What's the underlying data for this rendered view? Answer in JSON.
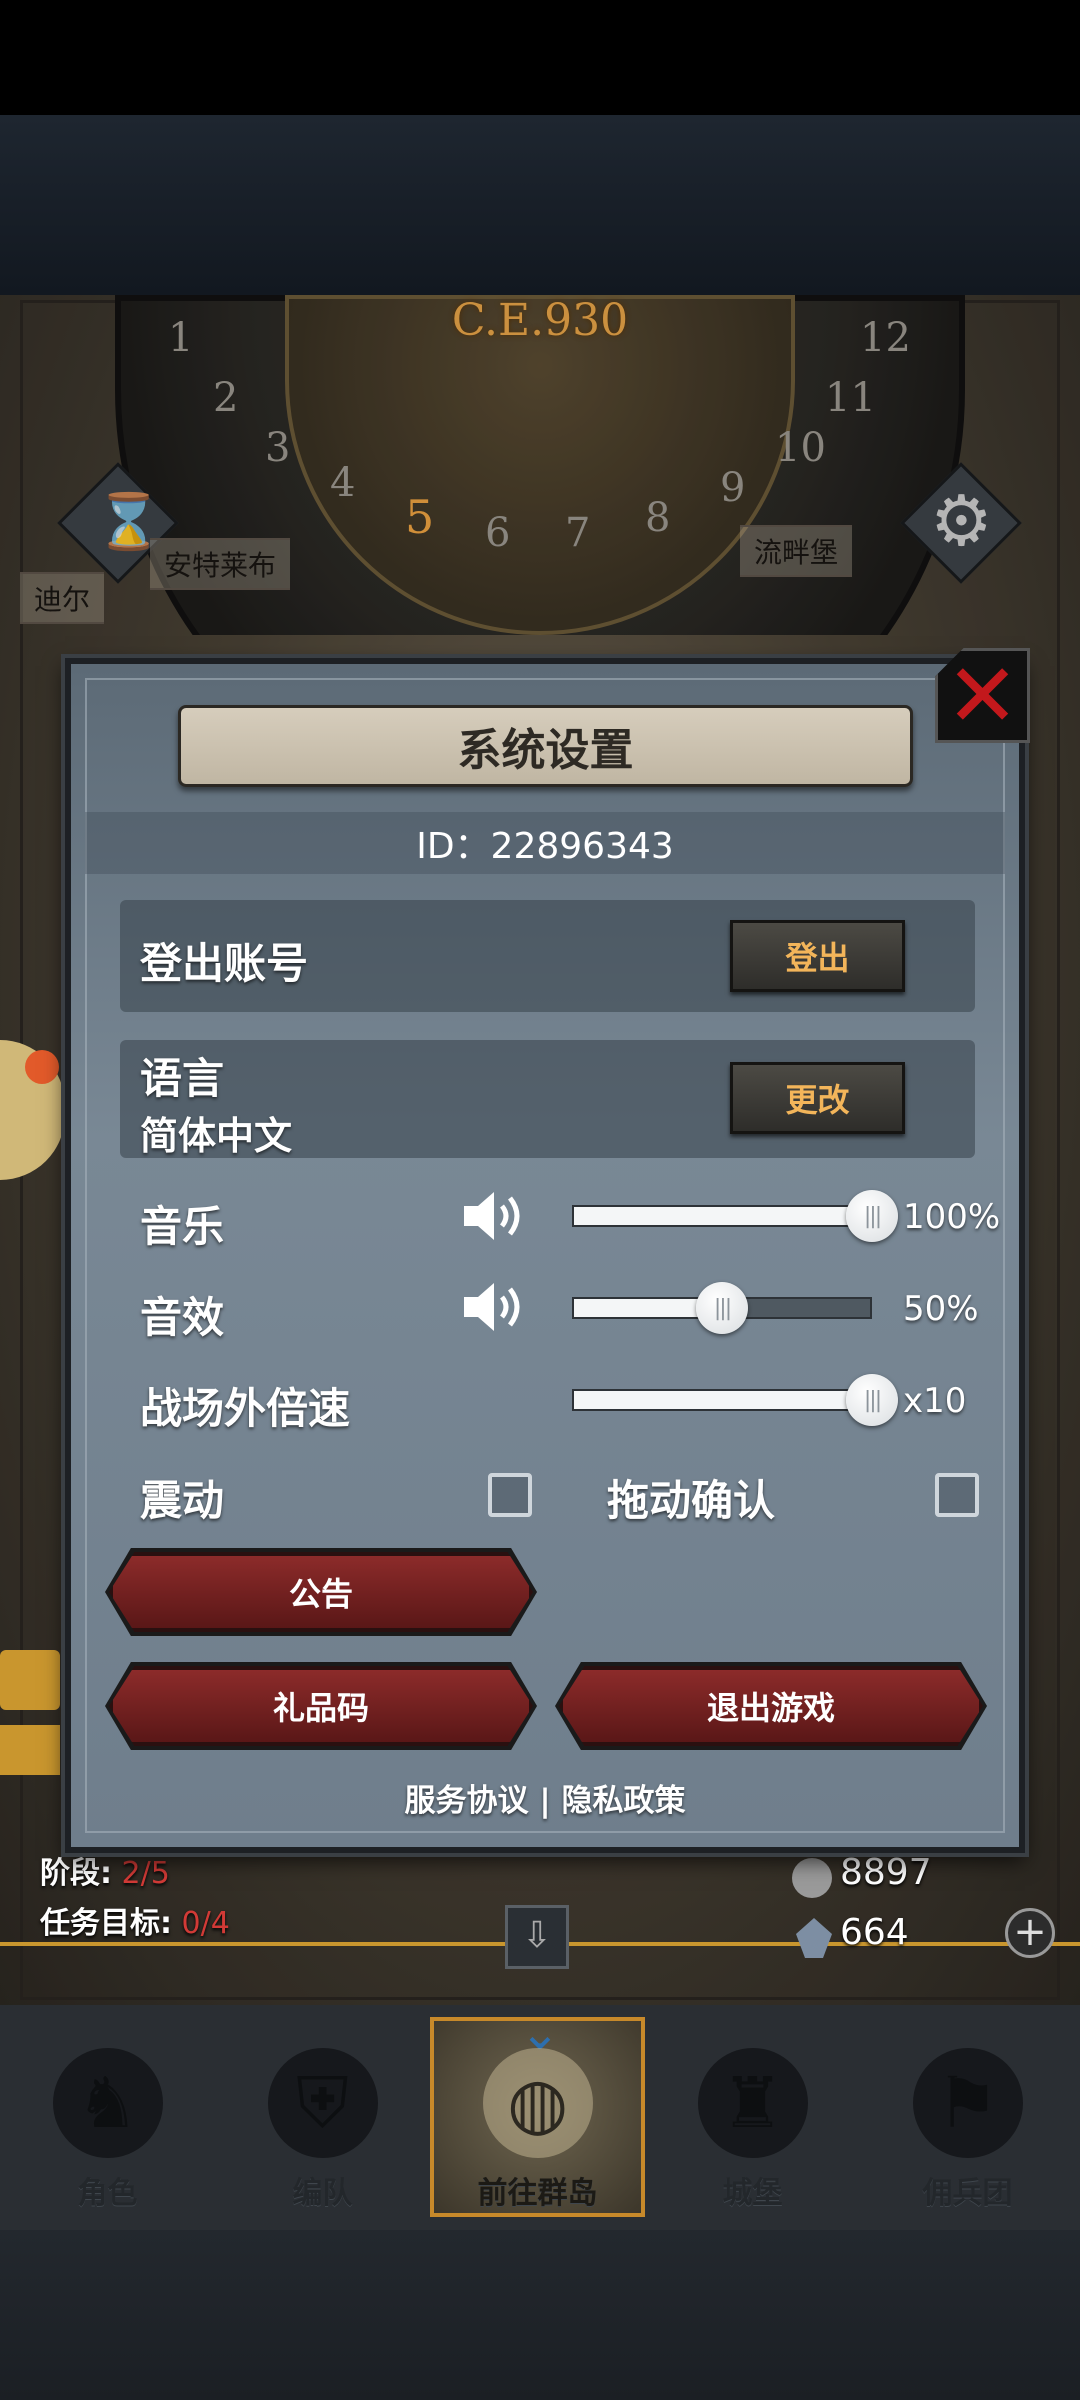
{
  "map": {
    "era": "C.E.930",
    "dial_numbers": [
      "1",
      "2",
      "3",
      "4",
      "5",
      "6",
      "7",
      "8",
      "9",
      "10",
      "11",
      "12"
    ],
    "current_number": "5",
    "places": [
      "安特莱布",
      "流畔堡",
      "迪尔"
    ]
  },
  "dialog": {
    "title": "系统设置",
    "id_text": "ID：22896343",
    "logout": {
      "label": "登出账号",
      "button": "登出"
    },
    "language": {
      "label": "语言",
      "value": "简体中文",
      "button": "更改"
    },
    "music": {
      "label": "音乐",
      "value_text": "100%",
      "level": 1.0
    },
    "sfx": {
      "label": "音效",
      "value_text": "50%",
      "level": 0.5
    },
    "battle_speed": {
      "label": "战场外倍速",
      "value_text": "x10",
      "level": 1.0
    },
    "vibration": {
      "label": "震动",
      "checked": false
    },
    "drag_confirm": {
      "label": "拖动确认",
      "checked": false
    },
    "buttons": {
      "announcement": "公告",
      "gift_code": "礼品码",
      "exit_game": "退出游戏"
    },
    "links": {
      "service": "服务协议",
      "separator": "|",
      "privacy": "隐私政策"
    }
  },
  "hud": {
    "stage_label": "阶段:",
    "stage_value": "2/5",
    "task_label": "任务目标:",
    "task_value": "0/4",
    "silver": "8897",
    "crystal": "664"
  },
  "nav": {
    "items": [
      "角色",
      "编队",
      "前往群岛",
      "城堡",
      "佣兵团"
    ],
    "active_index": 2
  },
  "colors": {
    "accent": "#e7a448",
    "close_red": "#c3181c",
    "button_red": "#8c2b2a",
    "button_text": "#f3b55a"
  }
}
